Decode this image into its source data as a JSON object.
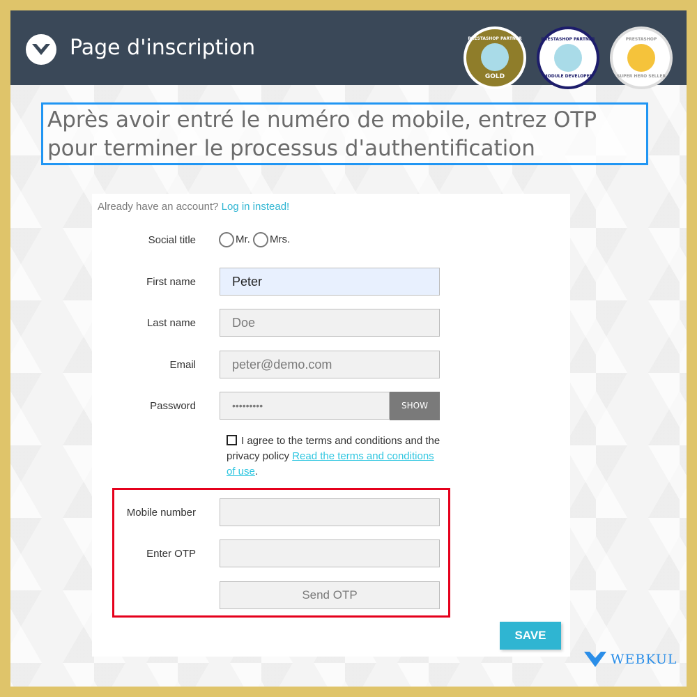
{
  "header": {
    "title": "Page d'inscription",
    "badges": [
      {
        "text": "PRESTASHOP PARTNER",
        "sub": "GOLD",
        "color": "#8f7d2a"
      },
      {
        "text": "PRESTASHOP PARTNER",
        "sub": "MODULE DEVELOPER",
        "color": "#ffffff"
      },
      {
        "text": "PRESTASHOP",
        "sub": "SUPER HERO SELLER",
        "color": "#ffffff"
      }
    ]
  },
  "banner": "Après avoir entré le numéro de mobile, entrez OTP pour terminer le processus d'authentification",
  "form": {
    "already": "Already have an account?",
    "login_link": "Log in instead!",
    "social_title": "Social title",
    "mr": "Mr.",
    "mrs": "Mrs.",
    "first_name_label": "First name",
    "first_name": "Peter",
    "last_name_label": "Last name",
    "last_name": "Doe",
    "email_label": "Email",
    "email": "peter@demo.com",
    "password_label": "Password",
    "password": "•••••••••",
    "show": "SHOW",
    "agree": "I agree to the terms and conditions and the privacy policy",
    "terms_link": "Read the terms and conditions of use",
    "period": ".",
    "mobile_label": "Mobile number",
    "mobile": "",
    "otp_label": "Enter OTP",
    "otp": "",
    "send_otp": "Send OTP",
    "save": "SAVE"
  },
  "brand": "WEBKUL",
  "colors": {
    "header": "#3a4858",
    "accent": "#2fb5d2",
    "highlight": "#e5001c",
    "banner_border": "#2196f3"
  }
}
